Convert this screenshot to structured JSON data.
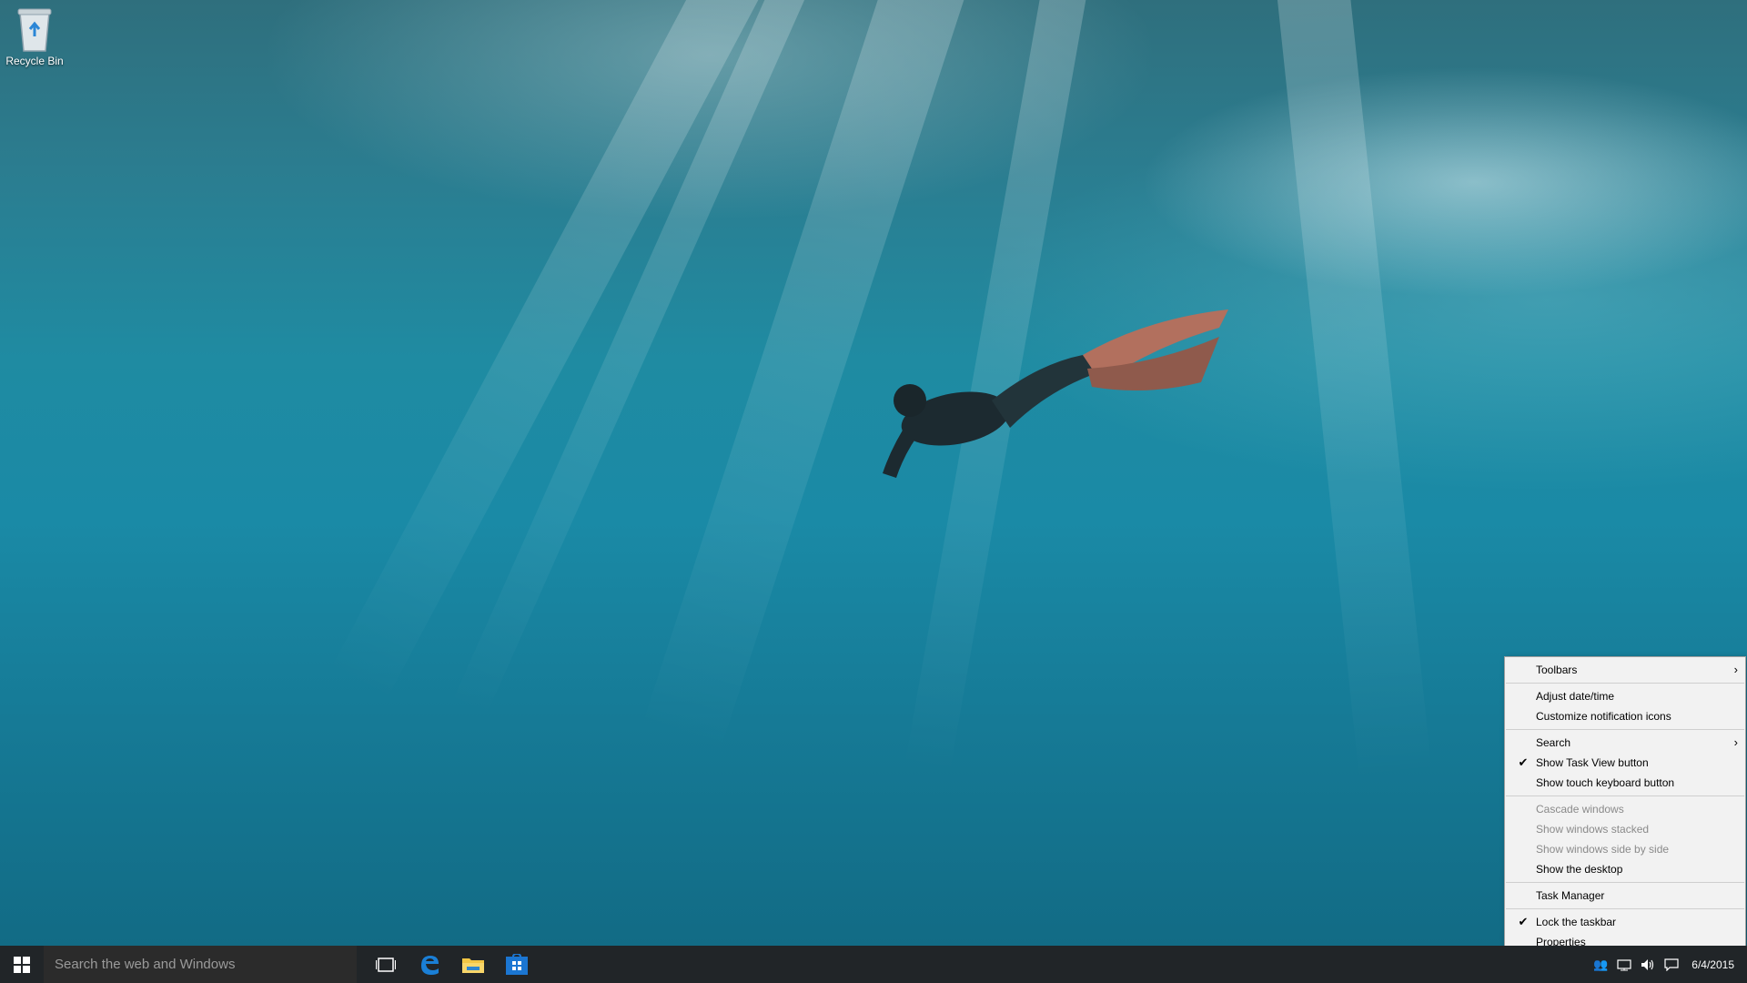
{
  "desktop": {
    "icons": [
      {
        "label": "Recycle Bin",
        "icon": "recycle-bin-icon"
      }
    ]
  },
  "taskbar": {
    "start_icon": "windows-logo-icon",
    "search_placeholder": "Search the web and Windows",
    "pinned": [
      {
        "name": "task-view",
        "icon": "task-view-icon"
      },
      {
        "name": "edge",
        "icon": "edge-icon"
      },
      {
        "name": "file-explorer",
        "icon": "folder-icon"
      },
      {
        "name": "store",
        "icon": "store-icon"
      }
    ],
    "clock": {
      "date": "6/4/2015"
    },
    "tray_icons": [
      "people-icon",
      "network-icon",
      "volume-icon",
      "action-center-icon"
    ]
  },
  "context_menu": {
    "items": [
      {
        "label": "Toolbars",
        "submenu": true
      },
      {
        "label": "Adjust date/time"
      },
      {
        "label": "Customize notification icons"
      },
      {
        "label": "Search",
        "submenu": true
      },
      {
        "label": "Show Task View button",
        "checked": true
      },
      {
        "label": "Show touch keyboard button"
      },
      {
        "label": "Cascade windows",
        "disabled": true
      },
      {
        "label": "Show windows stacked",
        "disabled": true
      },
      {
        "label": "Show windows side by side",
        "disabled": true
      },
      {
        "label": "Show the desktop"
      },
      {
        "label": "Task Manager"
      },
      {
        "label": "Lock the taskbar",
        "checked": true
      },
      {
        "label": "Properties"
      }
    ],
    "check_glyph": "✔",
    "arrow_glyph": "›"
  },
  "colors": {
    "taskbar_bg": "#0e1216",
    "search_bg": "#2b2b2b",
    "accent_blue": "#0078d7",
    "menu_bg": "#f2f2f2"
  }
}
